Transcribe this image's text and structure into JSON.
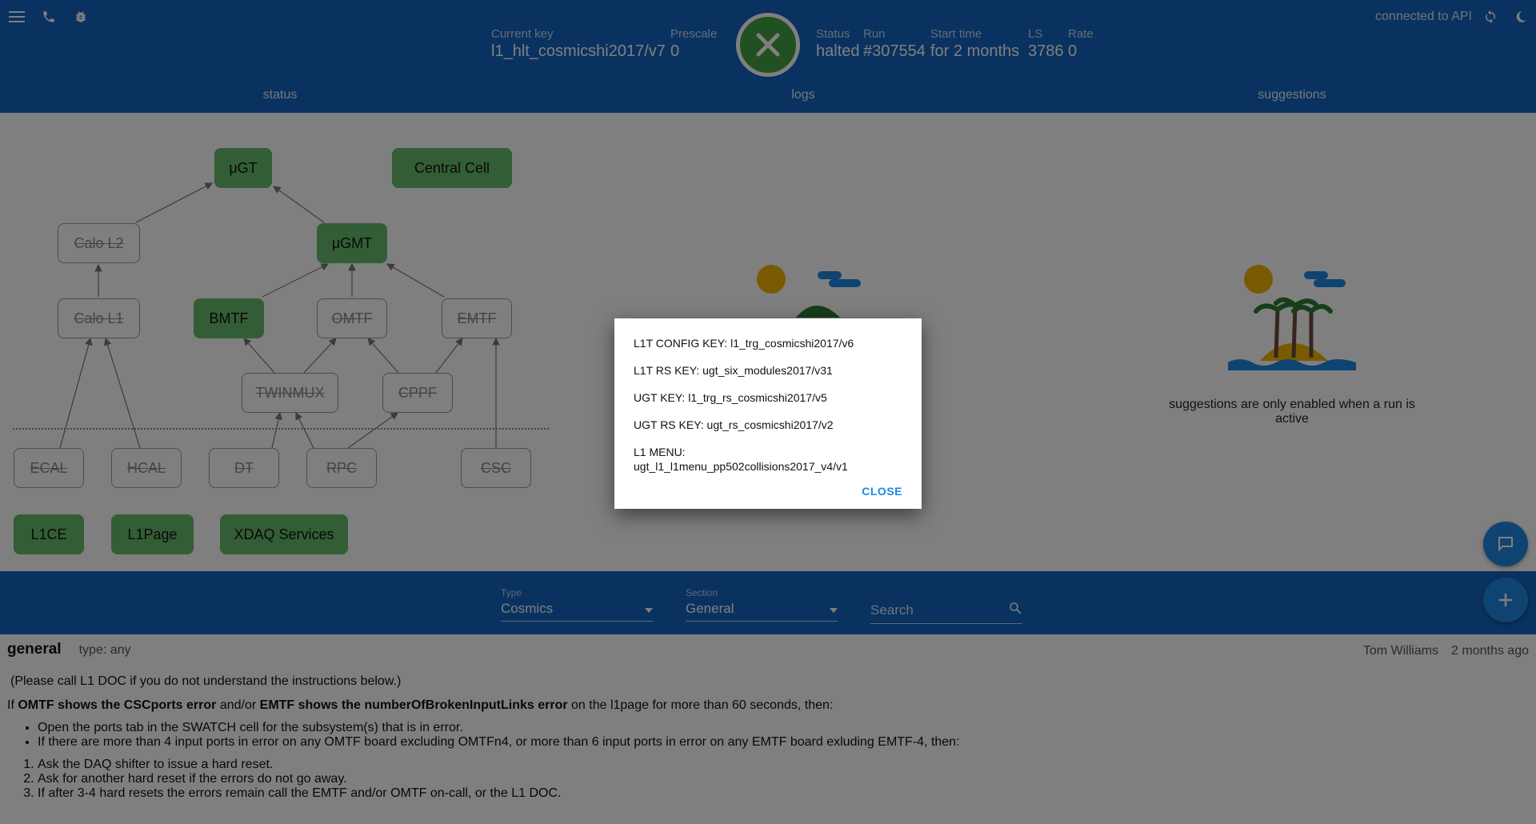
{
  "header": {
    "current_key_label": "Current key",
    "current_key": "l1_hlt_cosmicshi2017/v7",
    "prescale_label": "Prescale",
    "prescale": "0",
    "status_label": "Status",
    "status": "halted",
    "run_label": "Run",
    "run": "#307554",
    "start_time_label": "Start time",
    "start_time": "for 2 months",
    "ls_label": "LS",
    "ls": "3786",
    "rate_label": "Rate",
    "rate": "0",
    "api_status": "connected to API"
  },
  "tabs": [
    {
      "label": "status"
    },
    {
      "label": "logs"
    },
    {
      "label": "suggestions"
    }
  ],
  "diagram": {
    "nodes": {
      "ugt": "μGT",
      "central_cell": "Central Cell",
      "calo_l2": "Calo L2",
      "ugmt": "μGMT",
      "calo_l1": "Calo L1",
      "bmtf": "BMTF",
      "omtf": "OMTF",
      "emtf": "EMTF",
      "twinmux": "TWINMUX",
      "cppf": "CPPF",
      "ecal": "ECAL",
      "hcal": "HCAL",
      "dt": "DT",
      "rpc": "RPC",
      "csc": "CSC"
    },
    "links": {
      "l1ce": "L1CE",
      "l1page": "L1Page",
      "xdaq": "XDAQ Services"
    }
  },
  "suggestions": {
    "message": "suggestions are only enabled when a run is active"
  },
  "filters": {
    "type_label": "Type",
    "type_value": "Cosmics",
    "section_label": "Section",
    "section_value": "General",
    "search_placeholder": "Search"
  },
  "instruction": {
    "title": "general",
    "type": "type: any",
    "author": "Tom Williams",
    "age": "2 months ago",
    "intro": "(Please call L1 DOC if you do not understand the instructions below.)",
    "cond_if": "If ",
    "cond_bold1": "OMTF shows the CSCports error",
    "cond_mid": " and/or ",
    "cond_bold2": "EMTF shows the numberOfBrokenInputLinks error",
    "cond_end": " on the l1page for more than 60 seconds, then:",
    "bullets": [
      "Open the ports tab in the SWATCH cell for the subsystem(s) that is in error.",
      "If there are more than 4 input ports in error on any OMTF board excluding OMTFn4, or more than 6 input ports in error on any EMTF board exluding EMTF-4, then:"
    ],
    "steps": [
      "Ask the DAQ shifter to issue a hard reset.",
      "Ask for another hard reset if the errors do not go away.",
      "If after 3-4 hard resets the errors remain call the EMTF and/or OMTF on-call, or the L1 DOC."
    ]
  },
  "dialog": {
    "lines": [
      "L1T CONFIG KEY: l1_trg_cosmicshi2017/v6",
      "L1T RS KEY: ugt_six_modules2017/v31",
      "UGT KEY: l1_trg_rs_cosmicshi2017/v5",
      "UGT RS KEY: ugt_rs_cosmicshi2017/v2",
      "L1 MENU: ugt_l1_l1menu_pp502collisions2017_v4/v1"
    ],
    "close_label": "CLOSE"
  },
  "colors": {
    "primary": "#1565c0",
    "ok_node": "#66bb6a",
    "status_ok": "#43a047",
    "accent": "#1e88e5"
  }
}
